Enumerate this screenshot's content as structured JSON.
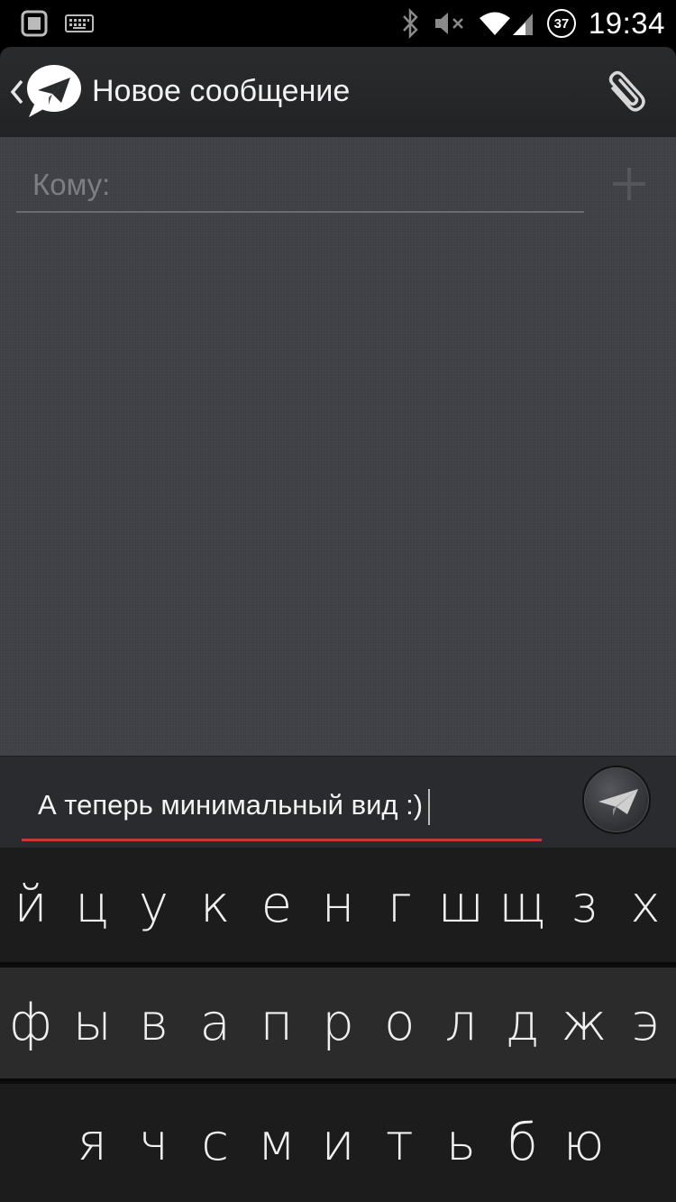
{
  "status_bar": {
    "time": "19:34",
    "battery_level": "37",
    "icons": [
      "screenshot-icon",
      "keyboard-icon",
      "bluetooth-icon",
      "mute-icon",
      "wifi-icon",
      "signal-icon",
      "battery-icon"
    ]
  },
  "action_bar": {
    "title": "Новое сообщение",
    "back_icon": "chevron-left-icon",
    "logo_icon": "paper-plane-logo-icon",
    "attach_icon": "paperclip-icon"
  },
  "recipient": {
    "placeholder": "Кому:",
    "add_icon": "plus-icon"
  },
  "compose": {
    "message_text": "А теперь минимальный вид :)",
    "send_icon": "paper-plane-icon",
    "accent_color": "#c2393a"
  },
  "keyboard": {
    "row1": [
      "й",
      "ц",
      "у",
      "к",
      "е",
      "н",
      "г",
      "ш",
      "щ",
      "з",
      "х"
    ],
    "row2": [
      "ф",
      "ы",
      "в",
      "а",
      "п",
      "р",
      "о",
      "л",
      "д",
      "ж",
      "э"
    ],
    "row3": [
      "я",
      "ч",
      "с",
      "м",
      "и",
      "т",
      "ь",
      "б",
      "ю"
    ]
  }
}
